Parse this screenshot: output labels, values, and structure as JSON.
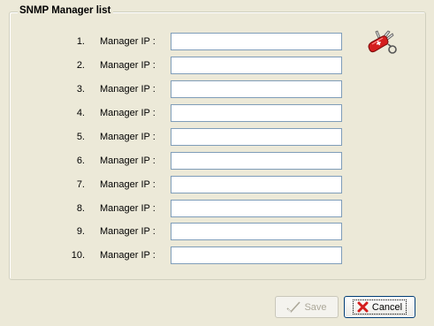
{
  "group": {
    "title": "SNMP Manager list"
  },
  "managers": [
    {
      "number": "1.",
      "label": "Manager IP :",
      "value": ""
    },
    {
      "number": "2.",
      "label": "Manager IP :",
      "value": ""
    },
    {
      "number": "3.",
      "label": "Manager IP :",
      "value": ""
    },
    {
      "number": "4.",
      "label": "Manager IP :",
      "value": ""
    },
    {
      "number": "5.",
      "label": "Manager IP :",
      "value": ""
    },
    {
      "number": "6.",
      "label": "Manager IP :",
      "value": ""
    },
    {
      "number": "7.",
      "label": "Manager IP :",
      "value": ""
    },
    {
      "number": "8.",
      "label": "Manager IP :",
      "value": ""
    },
    {
      "number": "9.",
      "label": "Manager IP :",
      "value": ""
    },
    {
      "number": "10.",
      "label": "Manager IP :",
      "value": ""
    }
  ],
  "icons": {
    "tool": "swiss-army-knife-icon",
    "save": "checkmark-icon",
    "cancel": "red-x-icon"
  },
  "buttons": {
    "save_label": "Save",
    "save_enabled": false,
    "cancel_label": "Cancel"
  },
  "colors": {
    "dialog_background": "#ECE9D8",
    "input_border": "#7F9DB9",
    "cancel_x": "#D41E1E",
    "disabled_text": "#ACA899"
  }
}
